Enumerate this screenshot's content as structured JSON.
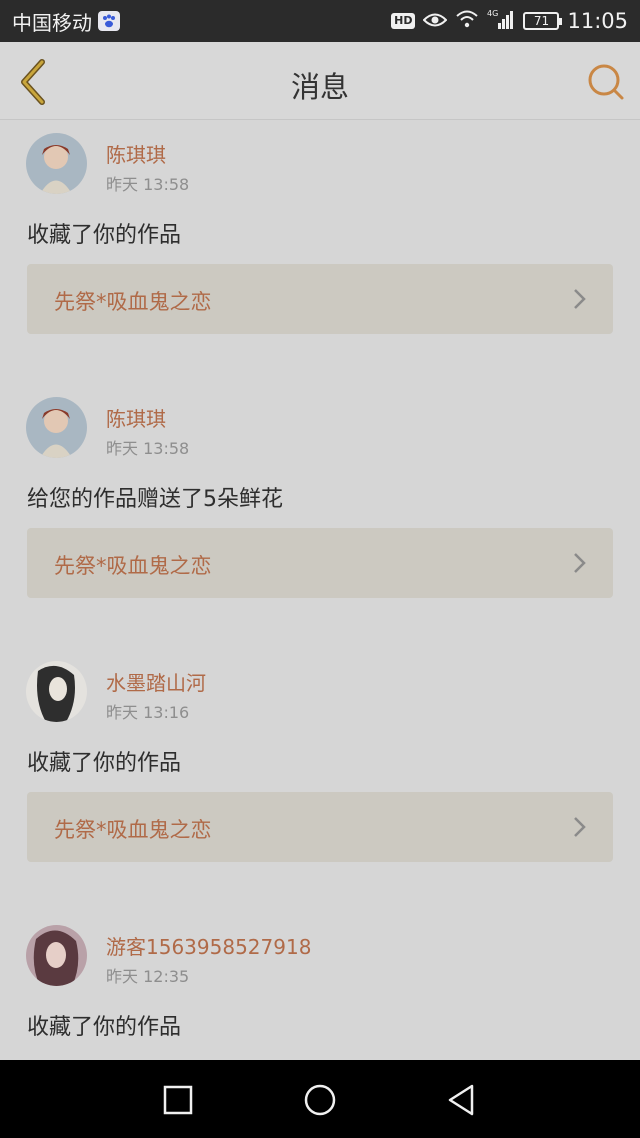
{
  "status_bar": {
    "carrier": "中国移动",
    "hd": "HD",
    "network": "4G",
    "battery": "71",
    "time": "11:05"
  },
  "header": {
    "title": "消息",
    "back_icon": "chevron-left-icon",
    "search_icon": "search-icon",
    "accent_color": "#c08a3a"
  },
  "messages": [
    {
      "user": "陈琪琪",
      "time": "昨天 13:58",
      "action": "收藏了你的作品",
      "work": "先祭*吸血鬼之恋",
      "avatar": "anime-girl-avatar"
    },
    {
      "user": "陈琪琪",
      "time": "昨天 13:58",
      "action": "给您的作品赠送了5朵鲜花",
      "work": "先祭*吸血鬼之恋",
      "avatar": "anime-girl-avatar"
    },
    {
      "user": "水墨踏山河",
      "time": "昨天 13:16",
      "action": "收藏了你的作品",
      "work": "先祭*吸血鬼之恋",
      "avatar": "ink-portrait-avatar"
    },
    {
      "user": "游客1563958527918",
      "time": "昨天 12:35",
      "action": "收藏了你的作品",
      "work": "",
      "avatar": "girl-photo-avatar"
    }
  ],
  "colors": {
    "username": "#b06a48",
    "link_bg": "#ccc9c1",
    "background": "#d6d6d6"
  }
}
